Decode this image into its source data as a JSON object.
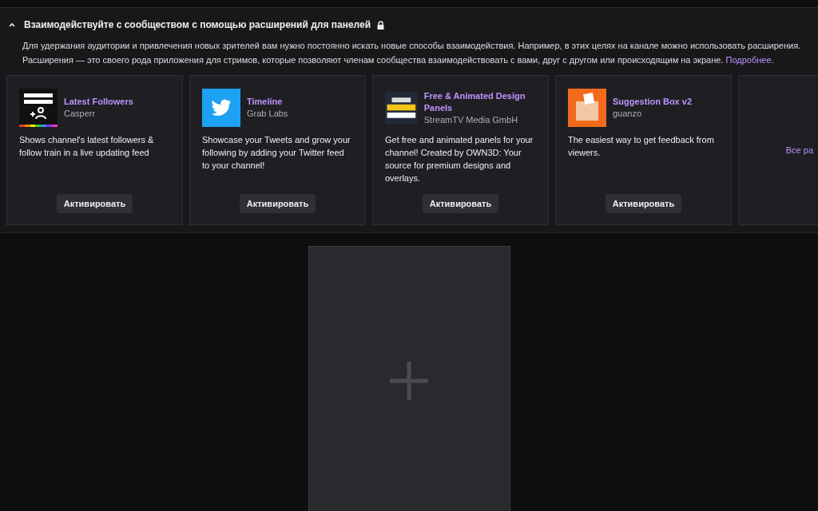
{
  "section": {
    "expanded": true,
    "title": "Взаимодействуйте с сообществом с помощью расширений для панелей",
    "locked": true,
    "description": "Для удержания аудитории и привлечения новых зрителей вам нужно постоянно искать новые способы взаимодействия. Например, в этих целях на канале можно использовать расширения. Расширения — это своего рода приложения для стримов, которые позволяют членам сообщества взаимодействовать с вами, друг с другом или происходящим на экране.",
    "learn_more": "Подробнее."
  },
  "extensions": [
    {
      "kind": "followers",
      "name": "Latest Followers",
      "author": "Casperr",
      "description": "Shows channel's latest followers & follow train in a live updating feed",
      "button": "Активировать"
    },
    {
      "kind": "twitter",
      "name": "Timeline",
      "author": "Grab Labs",
      "description": "Showcase your Tweets and grow your following by adding your Twitter feed to your channel!",
      "button": "Активировать"
    },
    {
      "kind": "panels",
      "name": "Free & Animated Design Panels",
      "author": "StreamTV Media GmbH",
      "description": "Get free and animated panels for your channel! Created by OWN3D: Your source for premium designs and overlays.",
      "button": "Активировать"
    },
    {
      "kind": "box",
      "name": "Suggestion Box v2",
      "author": "guanzo",
      "description": "The easiest way to get feedback from viewers.",
      "button": "Активировать"
    }
  ],
  "see_all": "Все ра"
}
